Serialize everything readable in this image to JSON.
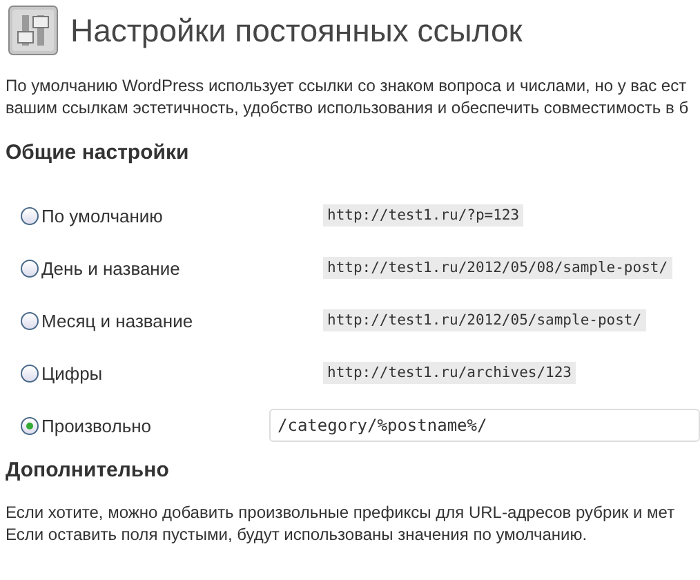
{
  "title": "Настройки постоянных ссылок",
  "intro": [
    "По умолчанию WordPress использует ссылки со знаком вопроса и числами, но у вас ест",
    "вашим ссылкам эстетичность, удобство использования и обеспечить совместимость в б"
  ],
  "general_heading": "Общие настройки",
  "options": [
    {
      "kind": "example",
      "label": "По умолчанию",
      "selected": false,
      "example": "http://test1.ru/?p=123"
    },
    {
      "kind": "example",
      "label": "День и название",
      "selected": false,
      "example": "http://test1.ru/2012/05/08/sample-post/"
    },
    {
      "kind": "example",
      "label": "Месяц и название",
      "selected": false,
      "example": "http://test1.ru/2012/05/sample-post/"
    },
    {
      "kind": "example",
      "label": "Цифры",
      "selected": false,
      "example": "http://test1.ru/archives/123"
    },
    {
      "kind": "input",
      "label": "Произвольно",
      "selected": true,
      "value": "/category/%postname%/"
    }
  ],
  "optional_heading": "Дополнительно",
  "optional_text": [
    "Если хотите, можно добавить произвольные префиксы для URL-адресов рубрик и мет",
    "Если оставить поля пустыми, будут использованы значения по умолчанию."
  ]
}
